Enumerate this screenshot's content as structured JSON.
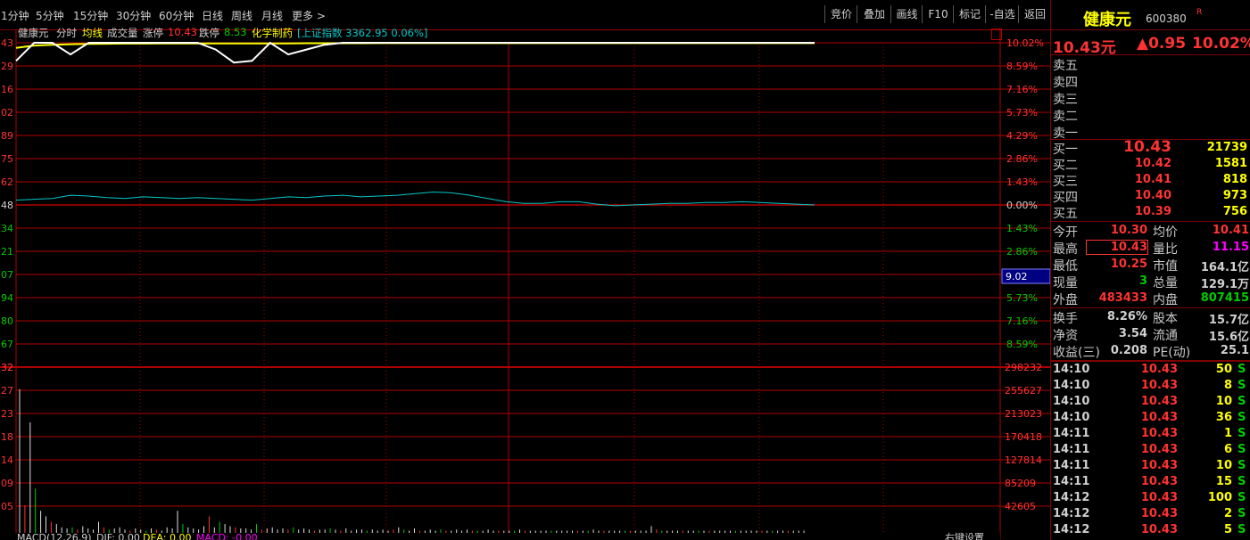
{
  "toolbar": {
    "periods": [
      "1分钟",
      "5分钟",
      "15分钟",
      "30分钟",
      "60分钟",
      "日线",
      "周线",
      "月线",
      "更多 >"
    ],
    "buttons": [
      "竞价",
      "叠加",
      "画线",
      "F10",
      "标记",
      "-自选",
      "返回"
    ]
  },
  "legend": {
    "name": "健康元",
    "mode": "分时",
    "avg_line": "均线",
    "volume": "成交量",
    "limit_up_label": "涨停",
    "limit_up": "10.43",
    "limit_down_label": "跌停",
    "limit_down": "8.53",
    "sector": "化学制药",
    "index_text": "[上证指数 3362.95 0.06%]"
  },
  "axes": {
    "left_price": [
      "43",
      "29",
      "16",
      "02",
      "89",
      "75",
      "62",
      "48",
      "34",
      "21",
      "07",
      "94",
      "80",
      "67",
      "32"
    ],
    "right_pct_up": [
      "10.02%",
      "8.59%",
      "7.16%",
      "5.73%",
      "4.29%",
      "2.86%",
      "1.43%"
    ],
    "right_zero": "0.00%",
    "right_pct_down": [
      "1.43%",
      "2.86%",
      "4.29%",
      "5.73%",
      "7.16%",
      "8.59%"
    ],
    "cursor_value": "9.02",
    "vol_left": [
      "27",
      "23",
      "18",
      "14",
      "09",
      "05"
    ],
    "vol_right": [
      "298232",
      "255627",
      "213023",
      "170418",
      "127814",
      "85209",
      "42605"
    ]
  },
  "macd": {
    "label": "MACD(12,26,9)",
    "dif": "DIF: 0.00",
    "dea": "DEA: 0.00",
    "macd": "MACD: -0.00",
    "right_setting": "右键设置"
  },
  "chart_data": {
    "type": "line",
    "series": [
      {
        "values_pct": [
          8.9,
          10.02,
          10.02,
          9.3,
          10.02,
          10.02,
          10.02,
          10.02,
          10.02,
          10.02,
          10.02,
          9.6,
          8.8,
          8.9,
          10.02,
          9.3,
          9.6,
          9.9,
          10.02,
          10.02,
          10.02,
          10.02,
          10.02,
          10.02,
          10.02,
          10.02,
          10.02,
          10.02,
          10.02,
          10.02,
          10.02,
          10.02,
          10.02,
          10.02,
          10.02,
          10.02,
          10.02,
          10.02,
          10.02,
          10.02,
          10.02,
          10.02,
          10.02,
          10.02,
          10.02
        ]
      },
      {
        "values_pct": [
          9.7,
          9.85,
          9.9,
          9.93,
          9.95,
          9.96,
          9.97,
          9.97,
          9.98,
          9.98,
          9.98,
          9.98,
          9.98,
          9.98,
          9.98,
          9.98,
          9.99,
          9.99,
          9.99,
          9.99,
          10.0,
          10.0,
          10.0,
          10.0,
          10.0,
          10.0,
          10.0,
          10.0,
          10.0,
          10.0,
          10.0,
          10.0,
          10.0,
          10.0,
          10.0,
          10.0,
          10.0,
          10.0,
          10.0,
          10.0,
          10.0,
          10.0,
          10.0,
          10.0,
          10.0
        ]
      },
      {
        "values_pct": [
          0.3,
          0.35,
          0.4,
          0.6,
          0.55,
          0.45,
          0.4,
          0.5,
          0.45,
          0.4,
          0.45,
          0.4,
          0.35,
          0.3,
          0.4,
          0.5,
          0.45,
          0.55,
          0.6,
          0.5,
          0.55,
          0.6,
          0.7,
          0.8,
          0.75,
          0.6,
          0.4,
          0.2,
          0.1,
          0.1,
          0.2,
          0.2,
          0.05,
          -0.05,
          0.0,
          0.05,
          0.1,
          0.1,
          0.15,
          0.15,
          0.2,
          0.15,
          0.1,
          0.05,
          0.0
        ]
      }
    ],
    "volumes": [
      130,
      25,
      100,
      40,
      20,
      15,
      10,
      8,
      5,
      4,
      5,
      3,
      6,
      4,
      3,
      10,
      5,
      3,
      4,
      5,
      3,
      2,
      4,
      3,
      2,
      4,
      3,
      2,
      5,
      4,
      20,
      8,
      5,
      4,
      3,
      6,
      15,
      5,
      10,
      8,
      6,
      5,
      4,
      4,
      3,
      8,
      3,
      4,
      5,
      3,
      4,
      3,
      5,
      3,
      4,
      3,
      2,
      3,
      3,
      4,
      3,
      2,
      4,
      2,
      3,
      3,
      2,
      3,
      2,
      3,
      2,
      3,
      5,
      3,
      2,
      4,
      2,
      2,
      3,
      2,
      3,
      2,
      2,
      3,
      2,
      3,
      2,
      2,
      2,
      3,
      2,
      2,
      2,
      2,
      2,
      3,
      2,
      2,
      2,
      2,
      2,
      2,
      2,
      2,
      2,
      2,
      2,
      2,
      2,
      3,
      2,
      2,
      2,
      2,
      2,
      2,
      2,
      2,
      2,
      2,
      6,
      3,
      2,
      2,
      2,
      2,
      2,
      2,
      2,
      2,
      2,
      2,
      2,
      2,
      2,
      2,
      2,
      2,
      2,
      2,
      2,
      2,
      2,
      2,
      2,
      2,
      2,
      2,
      2,
      2
    ]
  },
  "panel": {
    "stock_name": "健康元",
    "stock_code": "600380",
    "flag": "R",
    "price": "10.43元",
    "change": "▲0.95",
    "change_pct": "10.02%",
    "sells": [
      "卖五",
      "卖四",
      "卖三",
      "卖二",
      "卖一"
    ],
    "buys": [
      {
        "label": "买一",
        "price": "10.43",
        "vol": "21739"
      },
      {
        "label": "买二",
        "price": "10.42",
        "vol": "1581"
      },
      {
        "label": "买三",
        "price": "10.41",
        "vol": "818"
      },
      {
        "label": "买四",
        "price": "10.40",
        "vol": "973"
      },
      {
        "label": "买五",
        "price": "10.39",
        "vol": "756"
      }
    ],
    "stats": [
      {
        "l1": "今开",
        "v1": "10.30",
        "l2": "均价",
        "v2": "10.41"
      },
      {
        "l1": "最高",
        "v1": "10.43",
        "l2": "量比",
        "v2": "11.15"
      },
      {
        "l1": "最低",
        "v1": "10.25",
        "l2": "市值",
        "v2": "164.1亿"
      },
      {
        "l1": "现量",
        "v1": "3",
        "l2": "总量",
        "v2": "129.1万"
      },
      {
        "l1": "外盘",
        "v1": "483433",
        "l2": "内盘",
        "v2": "807415"
      }
    ],
    "fund": [
      {
        "l1": "换手",
        "v1": "8.26%",
        "l2": "股本",
        "v2": "15.7亿"
      },
      {
        "l1": "净资",
        "v1": "3.54",
        "l2": "流通",
        "v2": "15.6亿"
      },
      {
        "l1": "收益(三)",
        "v1": "0.208",
        "l2": "PE(动)",
        "v2": "25.1"
      }
    ],
    "ticks": [
      {
        "time": "14:10",
        "price": "10.43",
        "vol": "50",
        "side": "S"
      },
      {
        "time": "14:10",
        "price": "10.43",
        "vol": "8",
        "side": "S"
      },
      {
        "time": "14:10",
        "price": "10.43",
        "vol": "10",
        "side": "S"
      },
      {
        "time": "14:10",
        "price": "10.43",
        "vol": "36",
        "side": "S"
      },
      {
        "time": "14:11",
        "price": "10.43",
        "vol": "1",
        "side": "S"
      },
      {
        "time": "14:11",
        "price": "10.43",
        "vol": "6",
        "side": "S"
      },
      {
        "time": "14:11",
        "price": "10.43",
        "vol": "10",
        "side": "S"
      },
      {
        "time": "14:11",
        "price": "10.43",
        "vol": "15",
        "side": "S"
      },
      {
        "time": "14:12",
        "price": "10.43",
        "vol": "100",
        "side": "S"
      },
      {
        "time": "14:12",
        "price": "10.43",
        "vol": "2",
        "side": "S"
      },
      {
        "time": "14:12",
        "price": "10.43",
        "vol": "5",
        "side": "S"
      }
    ]
  },
  "colors": {
    "up": "#ff3333",
    "down": "#00cc00",
    "grid": "#b00000",
    "yellow": "#ffff00",
    "cyan": "#00c8c8"
  }
}
